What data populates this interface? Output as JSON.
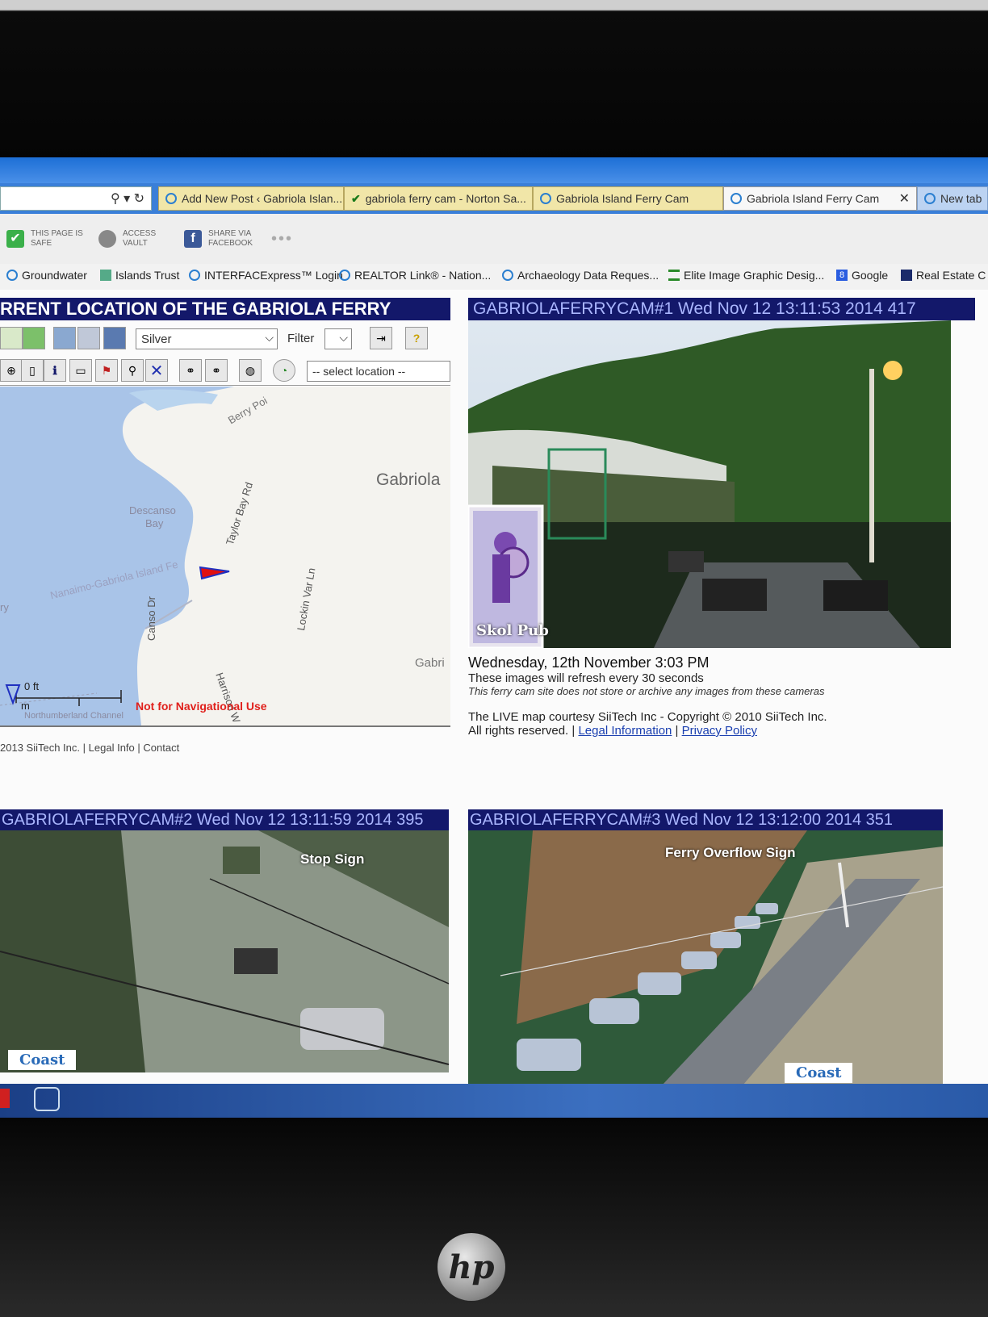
{
  "browser": {
    "tabs": [
      {
        "label": "Add New Post ‹ Gabriola Islan...",
        "icon": "ie-icon"
      },
      {
        "label": "gabriola ferry cam - Norton Sa...",
        "icon": "check-icon"
      },
      {
        "label": "Gabriola Island Ferry Cam",
        "icon": "ie-icon"
      },
      {
        "label": "Gabriola Island Ferry Cam",
        "icon": "ie-icon",
        "close": "✕"
      },
      {
        "label": "New tab",
        "icon": "ie-icon"
      }
    ],
    "address_icons": "⚲ ▾ ↻",
    "norton": [
      {
        "line1": "THIS PAGE IS",
        "line2": "SAFE"
      },
      {
        "line1": "ACCESS",
        "line2": "VAULT"
      },
      {
        "line1": "SHARE VIA",
        "line2": "FACEBOOK"
      }
    ],
    "more": "•••",
    "favorites": [
      "Groundwater",
      "Islands Trust",
      "INTERFACExpress™ Login",
      "REALTOR Link® - Nation...",
      "Archaeology Data Reques...",
      "Elite Image Graphic Desig...",
      "Google",
      "Real Estate C"
    ]
  },
  "map_panel": {
    "title": "RRENT LOCATION OF THE GABRIOLA FERRY",
    "style_select": "Silver",
    "filter_label": "Filter",
    "location_select": "-- select location --",
    "labels": {
      "berry_point": "Berry Poi",
      "gabriola": "Gabriola",
      "descanso": "Descanso",
      "bay": "Bay",
      "taylor_bay": "Taylor Bay Rd",
      "route": "Nanaimo-Gabriola Island Fe",
      "ry": "ry",
      "canso": "Canso Dr",
      "lockinvar": "Lockin Var Ln",
      "gabri": "Gabri",
      "harrison": "Harrison W",
      "northumberland": "Northumberland Channel",
      "scale_ft": "0 ft",
      "scale_m": "m"
    },
    "warning": "Not for Navigational Use",
    "footer": {
      "copyright": "2013 SiiTech Inc.",
      "legal": "Legal Info",
      "contact": "Contact",
      "sep": "|"
    }
  },
  "cam1": {
    "header": "GABRIOLAFERRYCAM#1 Wed Nov 12 13:11:53 2014 417",
    "pub_sign": "Skol Pub"
  },
  "info": {
    "date": "Wednesday, 12th November 3:03 PM",
    "refresh": "These images will refresh every 30 seconds",
    "note": "This ferry cam site does not store or archive any images from these cameras",
    "credit": "The LIVE map courtesy SiiTech Inc - Copyright © 2010 SiiTech Inc.",
    "rights": "All rights reserved.",
    "sep": "|",
    "legal_link": "Legal Information",
    "privacy_link": "Privacy Policy"
  },
  "cam2": {
    "header": "GABRIOLAFERRYCAM#2 Wed Nov 12 13:11:59 2014 395",
    "caption": "Stop Sign",
    "logo": "Coast"
  },
  "cam3": {
    "header": "GABRIOLAFERRYCAM#3 Wed Nov 12 13:12:00 2014 351",
    "caption": "Ferry Overflow Sign",
    "logo": "Coast"
  },
  "colors": {
    "header_bg": "#13186a",
    "warning": "#e0201c",
    "link": "#1a3fb0",
    "tab_yellow": "#f1e6a8"
  }
}
